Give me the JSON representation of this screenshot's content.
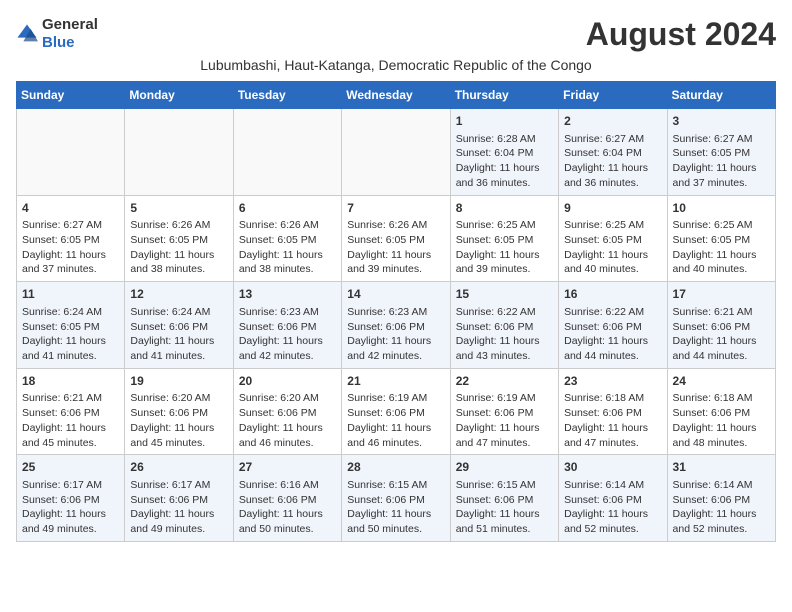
{
  "logo": {
    "general": "General",
    "blue": "Blue"
  },
  "title": "August 2024",
  "subtitle": "Lubumbashi, Haut-Katanga, Democratic Republic of the Congo",
  "headers": [
    "Sunday",
    "Monday",
    "Tuesday",
    "Wednesday",
    "Thursday",
    "Friday",
    "Saturday"
  ],
  "weeks": [
    [
      {
        "day": "",
        "info": ""
      },
      {
        "day": "",
        "info": ""
      },
      {
        "day": "",
        "info": ""
      },
      {
        "day": "",
        "info": ""
      },
      {
        "day": "1",
        "info": "Sunrise: 6:28 AM\nSunset: 6:04 PM\nDaylight: 11 hours and 36 minutes."
      },
      {
        "day": "2",
        "info": "Sunrise: 6:27 AM\nSunset: 6:04 PM\nDaylight: 11 hours and 36 minutes."
      },
      {
        "day": "3",
        "info": "Sunrise: 6:27 AM\nSunset: 6:05 PM\nDaylight: 11 hours and 37 minutes."
      }
    ],
    [
      {
        "day": "4",
        "info": "Sunrise: 6:27 AM\nSunset: 6:05 PM\nDaylight: 11 hours and 37 minutes."
      },
      {
        "day": "5",
        "info": "Sunrise: 6:26 AM\nSunset: 6:05 PM\nDaylight: 11 hours and 38 minutes."
      },
      {
        "day": "6",
        "info": "Sunrise: 6:26 AM\nSunset: 6:05 PM\nDaylight: 11 hours and 38 minutes."
      },
      {
        "day": "7",
        "info": "Sunrise: 6:26 AM\nSunset: 6:05 PM\nDaylight: 11 hours and 39 minutes."
      },
      {
        "day": "8",
        "info": "Sunrise: 6:25 AM\nSunset: 6:05 PM\nDaylight: 11 hours and 39 minutes."
      },
      {
        "day": "9",
        "info": "Sunrise: 6:25 AM\nSunset: 6:05 PM\nDaylight: 11 hours and 40 minutes."
      },
      {
        "day": "10",
        "info": "Sunrise: 6:25 AM\nSunset: 6:05 PM\nDaylight: 11 hours and 40 minutes."
      }
    ],
    [
      {
        "day": "11",
        "info": "Sunrise: 6:24 AM\nSunset: 6:05 PM\nDaylight: 11 hours and 41 minutes."
      },
      {
        "day": "12",
        "info": "Sunrise: 6:24 AM\nSunset: 6:06 PM\nDaylight: 11 hours and 41 minutes."
      },
      {
        "day": "13",
        "info": "Sunrise: 6:23 AM\nSunset: 6:06 PM\nDaylight: 11 hours and 42 minutes."
      },
      {
        "day": "14",
        "info": "Sunrise: 6:23 AM\nSunset: 6:06 PM\nDaylight: 11 hours and 42 minutes."
      },
      {
        "day": "15",
        "info": "Sunrise: 6:22 AM\nSunset: 6:06 PM\nDaylight: 11 hours and 43 minutes."
      },
      {
        "day": "16",
        "info": "Sunrise: 6:22 AM\nSunset: 6:06 PM\nDaylight: 11 hours and 44 minutes."
      },
      {
        "day": "17",
        "info": "Sunrise: 6:21 AM\nSunset: 6:06 PM\nDaylight: 11 hours and 44 minutes."
      }
    ],
    [
      {
        "day": "18",
        "info": "Sunrise: 6:21 AM\nSunset: 6:06 PM\nDaylight: 11 hours and 45 minutes."
      },
      {
        "day": "19",
        "info": "Sunrise: 6:20 AM\nSunset: 6:06 PM\nDaylight: 11 hours and 45 minutes."
      },
      {
        "day": "20",
        "info": "Sunrise: 6:20 AM\nSunset: 6:06 PM\nDaylight: 11 hours and 46 minutes."
      },
      {
        "day": "21",
        "info": "Sunrise: 6:19 AM\nSunset: 6:06 PM\nDaylight: 11 hours and 46 minutes."
      },
      {
        "day": "22",
        "info": "Sunrise: 6:19 AM\nSunset: 6:06 PM\nDaylight: 11 hours and 47 minutes."
      },
      {
        "day": "23",
        "info": "Sunrise: 6:18 AM\nSunset: 6:06 PM\nDaylight: 11 hours and 47 minutes."
      },
      {
        "day": "24",
        "info": "Sunrise: 6:18 AM\nSunset: 6:06 PM\nDaylight: 11 hours and 48 minutes."
      }
    ],
    [
      {
        "day": "25",
        "info": "Sunrise: 6:17 AM\nSunset: 6:06 PM\nDaylight: 11 hours and 49 minutes."
      },
      {
        "day": "26",
        "info": "Sunrise: 6:17 AM\nSunset: 6:06 PM\nDaylight: 11 hours and 49 minutes."
      },
      {
        "day": "27",
        "info": "Sunrise: 6:16 AM\nSunset: 6:06 PM\nDaylight: 11 hours and 50 minutes."
      },
      {
        "day": "28",
        "info": "Sunrise: 6:15 AM\nSunset: 6:06 PM\nDaylight: 11 hours and 50 minutes."
      },
      {
        "day": "29",
        "info": "Sunrise: 6:15 AM\nSunset: 6:06 PM\nDaylight: 11 hours and 51 minutes."
      },
      {
        "day": "30",
        "info": "Sunrise: 6:14 AM\nSunset: 6:06 PM\nDaylight: 11 hours and 52 minutes."
      },
      {
        "day": "31",
        "info": "Sunrise: 6:14 AM\nSunset: 6:06 PM\nDaylight: 11 hours and 52 minutes."
      }
    ]
  ]
}
